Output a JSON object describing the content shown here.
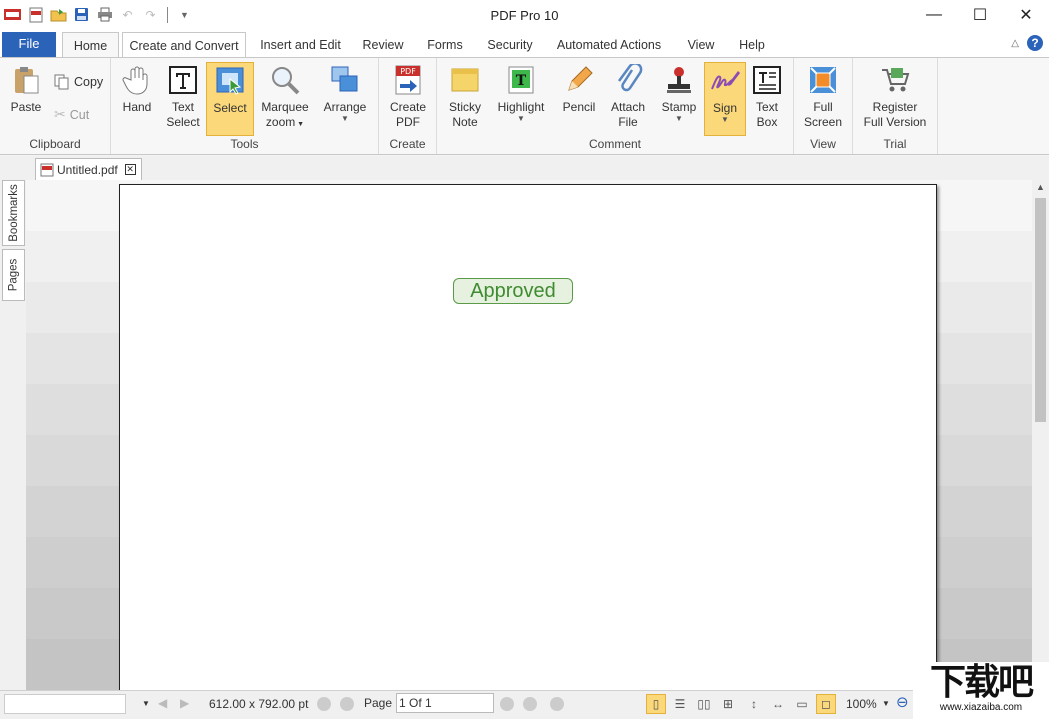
{
  "window": {
    "title": "PDF Pro 10"
  },
  "tabs": {
    "file": "File",
    "home": "Home",
    "create_convert": "Create and Convert",
    "insert_edit": "Insert and Edit",
    "review": "Review",
    "forms": "Forms",
    "security": "Security",
    "automated_actions": "Automated Actions",
    "view": "View",
    "help": "Help"
  },
  "help_symbol": "?",
  "ribbon": {
    "clipboard": {
      "label": "Clipboard",
      "paste": "Paste",
      "copy": "Copy",
      "cut": "Cut"
    },
    "tools": {
      "label": "Tools",
      "hand": "Hand",
      "text_select_1": "Text",
      "text_select_2": "Select",
      "select": "Select",
      "marquee_1": "Marquee",
      "marquee_2": "zoom",
      "arrange": "Arrange"
    },
    "create": {
      "label": "Create",
      "create_pdf_1": "Create",
      "create_pdf_2": "PDF"
    },
    "comment": {
      "label": "Comment",
      "sticky_1": "Sticky",
      "sticky_2": "Note",
      "highlight": "Highlight",
      "pencil": "Pencil",
      "attach_1": "Attach",
      "attach_2": "File",
      "stamp": "Stamp",
      "sign": "Sign",
      "textbox_1": "Text",
      "textbox_2": "Box"
    },
    "view": {
      "label": "View",
      "full_1": "Full",
      "full_2": "Screen"
    },
    "trial": {
      "label": "Trial",
      "register_1": "Register",
      "register_2": "Full Version"
    }
  },
  "document": {
    "tab_name": "Untitled.pdf",
    "stamp_text": "Approved"
  },
  "sidebar": {
    "bookmarks": "Bookmarks",
    "pages": "Pages"
  },
  "status": {
    "page_size": "612.00 x 792.00 pt",
    "page_label": "Page",
    "page_value": "1 Of 1",
    "zoom": "100%"
  },
  "watermark": {
    "logo": "下载吧",
    "url": "www.xiazaiba.com"
  },
  "colors": {
    "file_tab": "#2b63b9",
    "selected_tool": "#fbd87a",
    "stamp_green": "#3f8b31"
  }
}
